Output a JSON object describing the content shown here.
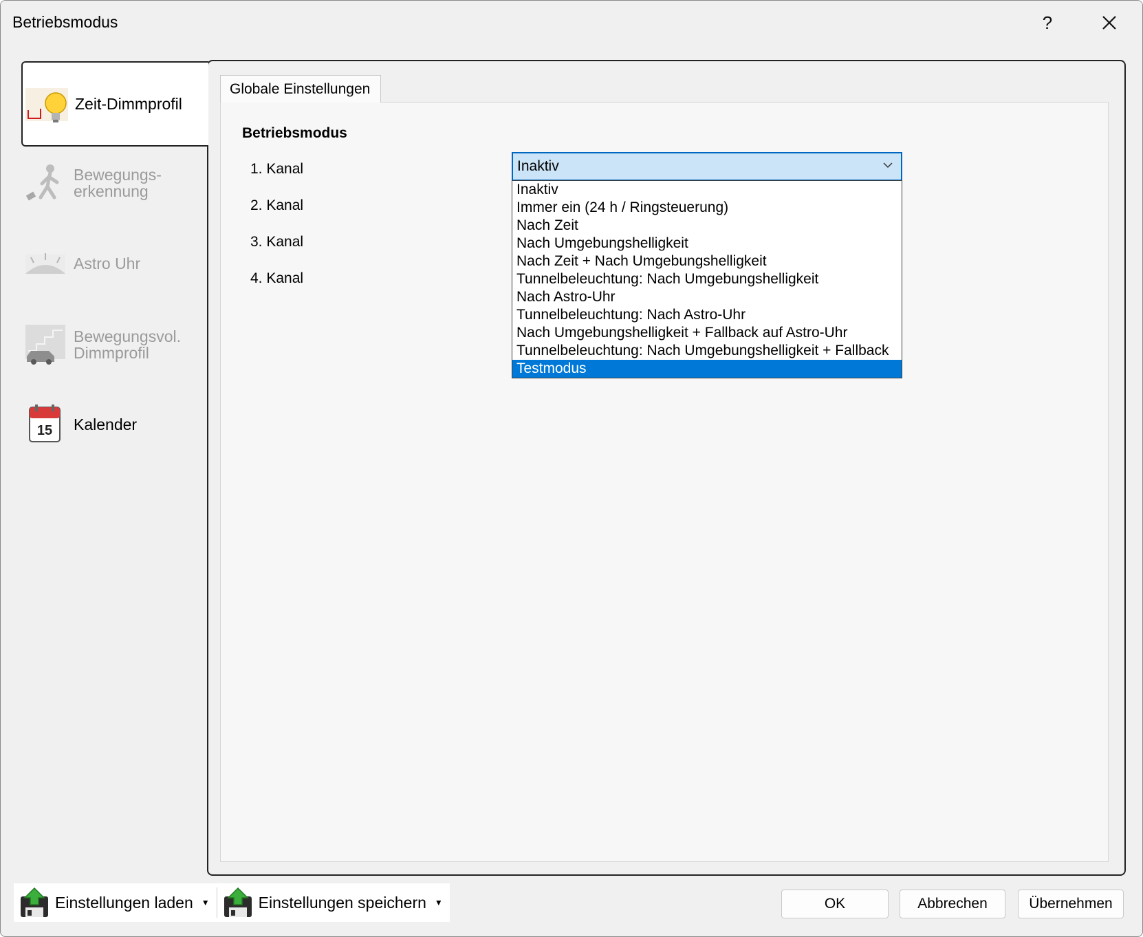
{
  "window": {
    "title": "Betriebsmodus",
    "help_label": "?",
    "close_label": "✕"
  },
  "nav": {
    "items": [
      {
        "label": "Zeit-Dimmprofil",
        "icon": "bulb-profile-icon",
        "state": "active"
      },
      {
        "label": "Bewegungs-\nerkennung",
        "icon": "motion-person-icon",
        "state": "disabled"
      },
      {
        "label": "Astro Uhr",
        "icon": "astro-horizon-icon",
        "state": "disabled"
      },
      {
        "label": "Bewegungsvol.\nDimmprofil",
        "icon": "car-stairs-icon",
        "state": "disabled"
      },
      {
        "label": "Kalender",
        "icon": "calendar-icon",
        "state": "enabled",
        "calendar_day": "15"
      }
    ]
  },
  "tabs": [
    {
      "label": "Globale Einstellungen",
      "selected": true
    }
  ],
  "main": {
    "section_title": "Betriebsmodus",
    "channels": [
      "1. Kanal",
      "2. Kanal",
      "3. Kanal",
      "4. Kanal"
    ],
    "select": {
      "value": "Inaktiv",
      "options": [
        "Inaktiv",
        "Immer ein (24 h / Ringsteuerung)",
        "Nach Zeit",
        "Nach Umgebungshelligkeit",
        "Nach Zeit + Nach Umgebungshelligkeit",
        "Tunnelbeleuchtung: Nach Umgebungshelligkeit",
        "Nach Astro-Uhr",
        "Tunnelbeleuchtung: Nach Astro-Uhr",
        "Nach Umgebungshelligkeit + Fallback auf Astro-Uhr",
        "Tunnelbeleuchtung: Nach Umgebungshelligkeit + Fallback",
        "Testmodus"
      ],
      "highlighted": "Testmodus"
    }
  },
  "footer": {
    "load_label": "Einstellungen laden",
    "save_label": "Einstellungen speichern",
    "ok_label": "OK",
    "cancel_label": "Abbrechen",
    "apply_label": "Übernehmen"
  },
  "colors": {
    "accent": "#0078d7",
    "select_bg": "#cce4f7",
    "disabled_text": "#9a9a9a"
  }
}
